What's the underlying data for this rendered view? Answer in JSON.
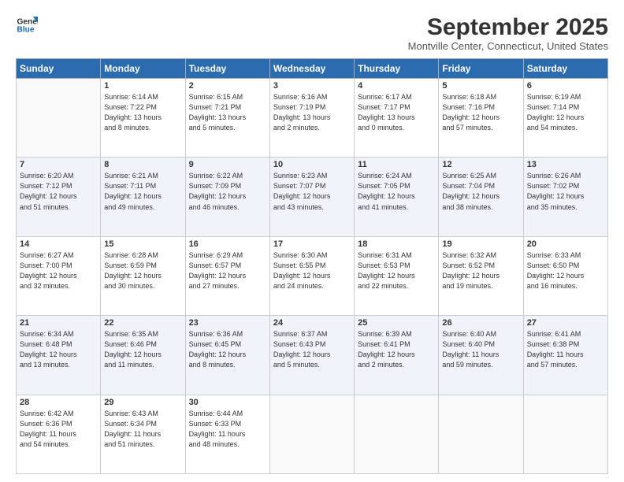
{
  "logo": {
    "line1": "General",
    "line2": "Blue"
  },
  "title": "September 2025",
  "location": "Montville Center, Connecticut, United States",
  "days_of_week": [
    "Sunday",
    "Monday",
    "Tuesday",
    "Wednesday",
    "Thursday",
    "Friday",
    "Saturday"
  ],
  "weeks": [
    [
      {
        "day": "",
        "info": ""
      },
      {
        "day": "1",
        "info": "Sunrise: 6:14 AM\nSunset: 7:22 PM\nDaylight: 13 hours\nand 8 minutes."
      },
      {
        "day": "2",
        "info": "Sunrise: 6:15 AM\nSunset: 7:21 PM\nDaylight: 13 hours\nand 5 minutes."
      },
      {
        "day": "3",
        "info": "Sunrise: 6:16 AM\nSunset: 7:19 PM\nDaylight: 13 hours\nand 2 minutes."
      },
      {
        "day": "4",
        "info": "Sunrise: 6:17 AM\nSunset: 7:17 PM\nDaylight: 13 hours\nand 0 minutes."
      },
      {
        "day": "5",
        "info": "Sunrise: 6:18 AM\nSunset: 7:16 PM\nDaylight: 12 hours\nand 57 minutes."
      },
      {
        "day": "6",
        "info": "Sunrise: 6:19 AM\nSunset: 7:14 PM\nDaylight: 12 hours\nand 54 minutes."
      }
    ],
    [
      {
        "day": "7",
        "info": "Sunrise: 6:20 AM\nSunset: 7:12 PM\nDaylight: 12 hours\nand 51 minutes."
      },
      {
        "day": "8",
        "info": "Sunrise: 6:21 AM\nSunset: 7:11 PM\nDaylight: 12 hours\nand 49 minutes."
      },
      {
        "day": "9",
        "info": "Sunrise: 6:22 AM\nSunset: 7:09 PM\nDaylight: 12 hours\nand 46 minutes."
      },
      {
        "day": "10",
        "info": "Sunrise: 6:23 AM\nSunset: 7:07 PM\nDaylight: 12 hours\nand 43 minutes."
      },
      {
        "day": "11",
        "info": "Sunrise: 6:24 AM\nSunset: 7:05 PM\nDaylight: 12 hours\nand 41 minutes."
      },
      {
        "day": "12",
        "info": "Sunrise: 6:25 AM\nSunset: 7:04 PM\nDaylight: 12 hours\nand 38 minutes."
      },
      {
        "day": "13",
        "info": "Sunrise: 6:26 AM\nSunset: 7:02 PM\nDaylight: 12 hours\nand 35 minutes."
      }
    ],
    [
      {
        "day": "14",
        "info": "Sunrise: 6:27 AM\nSunset: 7:00 PM\nDaylight: 12 hours\nand 32 minutes."
      },
      {
        "day": "15",
        "info": "Sunrise: 6:28 AM\nSunset: 6:59 PM\nDaylight: 12 hours\nand 30 minutes."
      },
      {
        "day": "16",
        "info": "Sunrise: 6:29 AM\nSunset: 6:57 PM\nDaylight: 12 hours\nand 27 minutes."
      },
      {
        "day": "17",
        "info": "Sunrise: 6:30 AM\nSunset: 6:55 PM\nDaylight: 12 hours\nand 24 minutes."
      },
      {
        "day": "18",
        "info": "Sunrise: 6:31 AM\nSunset: 6:53 PM\nDaylight: 12 hours\nand 22 minutes."
      },
      {
        "day": "19",
        "info": "Sunrise: 6:32 AM\nSunset: 6:52 PM\nDaylight: 12 hours\nand 19 minutes."
      },
      {
        "day": "20",
        "info": "Sunrise: 6:33 AM\nSunset: 6:50 PM\nDaylight: 12 hours\nand 16 minutes."
      }
    ],
    [
      {
        "day": "21",
        "info": "Sunrise: 6:34 AM\nSunset: 6:48 PM\nDaylight: 12 hours\nand 13 minutes."
      },
      {
        "day": "22",
        "info": "Sunrise: 6:35 AM\nSunset: 6:46 PM\nDaylight: 12 hours\nand 11 minutes."
      },
      {
        "day": "23",
        "info": "Sunrise: 6:36 AM\nSunset: 6:45 PM\nDaylight: 12 hours\nand 8 minutes."
      },
      {
        "day": "24",
        "info": "Sunrise: 6:37 AM\nSunset: 6:43 PM\nDaylight: 12 hours\nand 5 minutes."
      },
      {
        "day": "25",
        "info": "Sunrise: 6:39 AM\nSunset: 6:41 PM\nDaylight: 12 hours\nand 2 minutes."
      },
      {
        "day": "26",
        "info": "Sunrise: 6:40 AM\nSunset: 6:40 PM\nDaylight: 11 hours\nand 59 minutes."
      },
      {
        "day": "27",
        "info": "Sunrise: 6:41 AM\nSunset: 6:38 PM\nDaylight: 11 hours\nand 57 minutes."
      }
    ],
    [
      {
        "day": "28",
        "info": "Sunrise: 6:42 AM\nSunset: 6:36 PM\nDaylight: 11 hours\nand 54 minutes."
      },
      {
        "day": "29",
        "info": "Sunrise: 6:43 AM\nSunset: 6:34 PM\nDaylight: 11 hours\nand 51 minutes."
      },
      {
        "day": "30",
        "info": "Sunrise: 6:44 AM\nSunset: 6:33 PM\nDaylight: 11 hours\nand 48 minutes."
      },
      {
        "day": "",
        "info": ""
      },
      {
        "day": "",
        "info": ""
      },
      {
        "day": "",
        "info": ""
      },
      {
        "day": "",
        "info": ""
      }
    ]
  ]
}
